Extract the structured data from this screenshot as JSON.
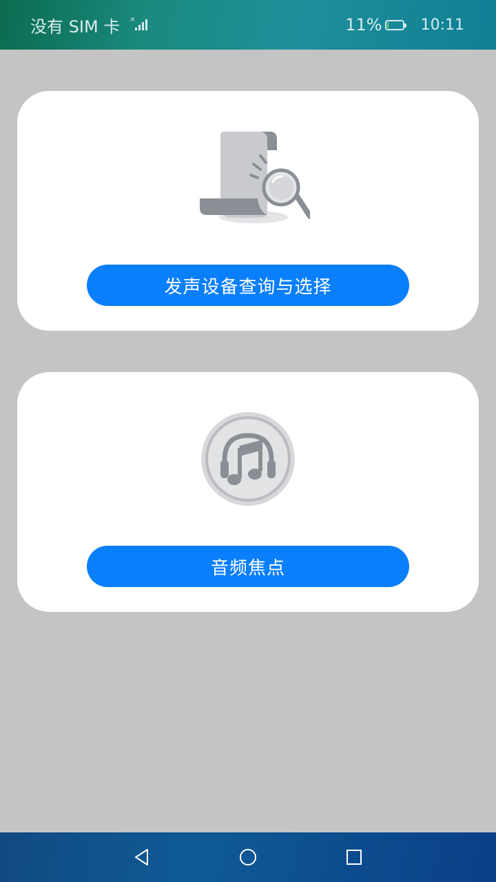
{
  "status_bar": {
    "carrier": "没有 SIM 卡",
    "signal_icon": "signal-no-sim-icon",
    "battery_percent": "11%",
    "battery_level": 0.11,
    "battery_fill_color": "#58d36a",
    "time": "10:11"
  },
  "cards": [
    {
      "illustration": "document-search-icon",
      "button_label": "发声设备查询与选择"
    },
    {
      "illustration": "music-headphones-icon",
      "button_label": "音频焦点"
    }
  ],
  "colors": {
    "background": "#c4c4c4",
    "card": "#ffffff",
    "button": "#0a7ffb",
    "button_text": "#ffffff"
  },
  "nav_bar": {
    "back_icon": "back-triangle-icon",
    "home_icon": "home-circle-icon",
    "recent_icon": "recent-square-icon"
  }
}
